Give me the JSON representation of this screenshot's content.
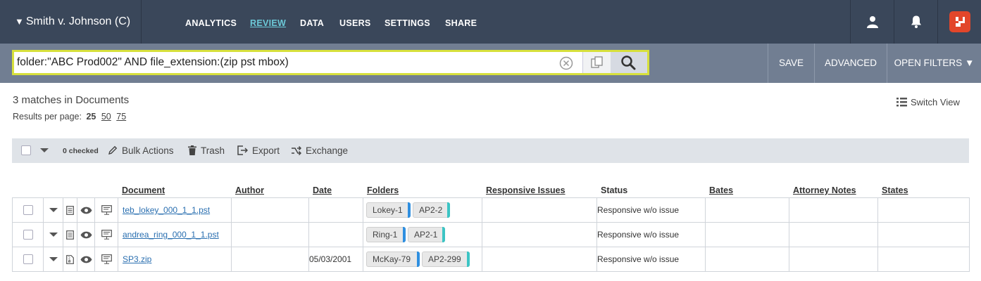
{
  "app": {
    "case_title": "Smith v. Johnson (C)"
  },
  "nav": {
    "items": [
      {
        "label": "ANALYTICS",
        "active": false
      },
      {
        "label": "REVIEW",
        "active": true
      },
      {
        "label": "DATA",
        "active": false
      },
      {
        "label": "USERS",
        "active": false
      },
      {
        "label": "SETTINGS",
        "active": false
      },
      {
        "label": "SHARE",
        "active": false
      }
    ],
    "icons": [
      "user-icon",
      "bell-icon",
      "brand-logo-icon"
    ]
  },
  "search": {
    "query": "folder:\"ABC Prod002\" AND file_extension:(zip pst mbox)",
    "buttons": {
      "save": "SAVE",
      "advanced": "ADVANCED",
      "open_filters": "OPEN FILTERS ▼"
    }
  },
  "results": {
    "matches": "3 matches in Documents",
    "per_page_label": "Results per page:",
    "per_page_current": "25",
    "per_page_options": [
      "50",
      "75"
    ],
    "switch_view": "Switch View"
  },
  "actions": {
    "checked": "0 checked",
    "bulk": "Bulk Actions",
    "trash": "Trash",
    "export": "Export",
    "exchange": "Exchange"
  },
  "table": {
    "columns": {
      "document": "Document",
      "author": "Author",
      "date": "Date",
      "folders": "Folders",
      "responsive_issues": "Responsive Issues",
      "status": "Status",
      "bates": "Bates",
      "attorney_notes": "Attorney Notes",
      "states": "States"
    },
    "rows": [
      {
        "document": "teb_lokey_000_1_1.pst",
        "author": "",
        "date": "",
        "folder1": "Lokey-1",
        "folder2": "AP2-2",
        "issues": "",
        "status": "Responsive w/o issue",
        "bates": "",
        "notes": "",
        "states": ""
      },
      {
        "document": "andrea_ring_000_1_1.pst",
        "author": "",
        "date": "",
        "folder1": "Ring-1",
        "folder2": "AP2-1",
        "issues": "",
        "status": "Responsive w/o issue",
        "bates": "",
        "notes": "",
        "states": ""
      },
      {
        "document": "SP3.zip",
        "author": "",
        "date": "05/03/2001",
        "folder1": "McKay-79",
        "folder2": "AP2-299",
        "issues": "",
        "status": "Responsive w/o issue",
        "bates": "",
        "notes": "",
        "states": ""
      }
    ]
  },
  "colors": {
    "nav_bg": "#3a475a",
    "search_bg": "#717e92",
    "accent_teal": "#6cc9d8",
    "tag_blue": "#2f8fe0",
    "tag_teal": "#3cc4c4",
    "highlight_yellow": "#d7e03c"
  }
}
